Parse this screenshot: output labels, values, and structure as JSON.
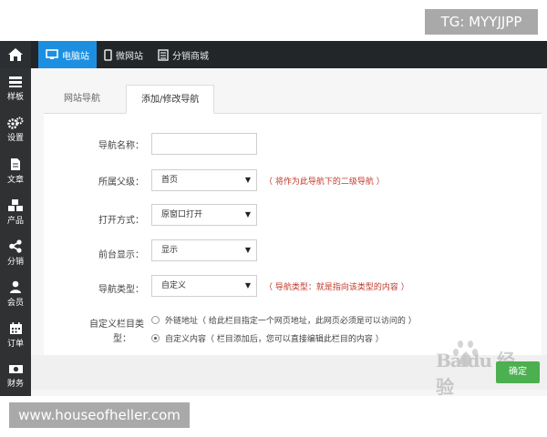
{
  "overlay": {
    "tg_badge": "TG: MYYJJPP",
    "site_badge": "www.houseofheller.com"
  },
  "topnav": {
    "items": [
      {
        "label": "电脑站",
        "icon": "monitor-icon",
        "active": true
      },
      {
        "label": "微网站",
        "icon": "mobile-icon",
        "active": false
      },
      {
        "label": "分销商城",
        "icon": "store-icon",
        "active": false
      }
    ]
  },
  "sidebar": {
    "items": [
      {
        "label": "样板",
        "icon": "template-icon"
      },
      {
        "label": "设置",
        "icon": "gear-icon"
      },
      {
        "label": "文章",
        "icon": "document-icon"
      },
      {
        "label": "产品",
        "icon": "cubes-icon"
      },
      {
        "label": "分销",
        "icon": "share-icon"
      },
      {
        "label": "会员",
        "icon": "user-icon"
      },
      {
        "label": "订单",
        "icon": "calendar-icon"
      },
      {
        "label": "财务",
        "icon": "money-icon"
      }
    ]
  },
  "tabs": [
    {
      "label": "网站导航",
      "active": false
    },
    {
      "label": "添加/修改导航",
      "active": true
    }
  ],
  "form": {
    "nav_name": {
      "label": "导航名称：",
      "value": ""
    },
    "parent": {
      "label": "所属父级：",
      "value": "首页",
      "hint": "（ 将作为此导航下的二级导航 ）"
    },
    "open_mode": {
      "label": "打开方式：",
      "value": "原窗口打开"
    },
    "display": {
      "label": "前台显示：",
      "value": "显示"
    },
    "nav_type": {
      "label": "导航类型：",
      "value": "自定义",
      "hint": "（ 导航类型：就是指向该类型的内容 ）"
    },
    "custom_type": {
      "label_line1": "自定义栏目类",
      "label_line2": "型：",
      "options": [
        {
          "label": "外链地址（ 给此栏目指定一个网页地址，此网页必须是可以访问的 ）",
          "selected": false
        },
        {
          "label": "自定义内容（ 栏目添加后，您可以直接编辑此栏目的内容 ）",
          "selected": true
        }
      ]
    },
    "confirm_label": "确定"
  },
  "colors": {
    "topbar": "#232628",
    "sidebar": "#2f3133",
    "accent": "#1d8fe0",
    "hint": "#c0392b",
    "confirm": "#4caf50"
  }
}
